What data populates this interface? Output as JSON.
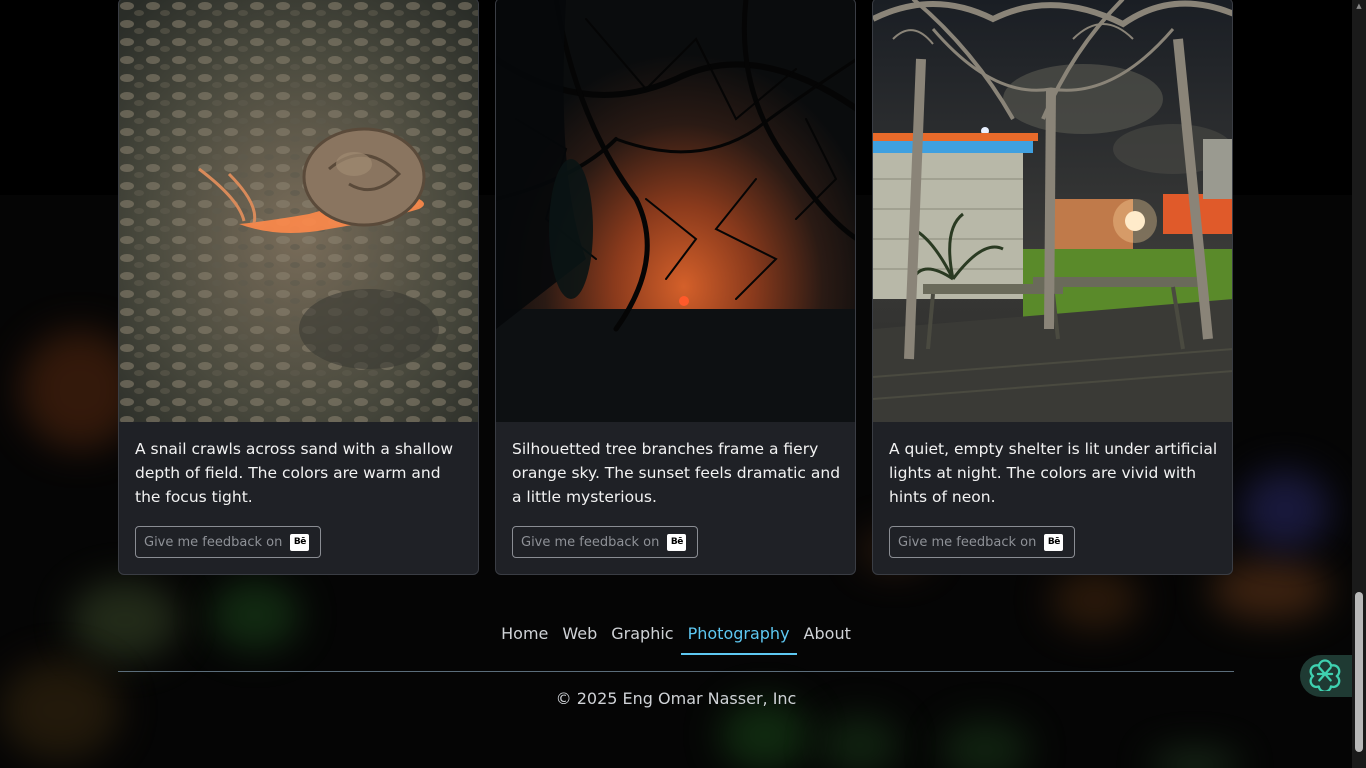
{
  "cards": [
    {
      "caption": "A snail crawls across sand with a shallow depth of field. The colors are warm and the focus tight.",
      "feedback_label": "Give me feedback on",
      "badge": "Bē"
    },
    {
      "caption": "Silhouetted tree branches frame a fiery orange sky. The sunset feels dramatic and a little mysterious.",
      "feedback_label": "Give me feedback on",
      "badge": "Bē"
    },
    {
      "caption": "A quiet, empty shelter is lit under artificial lights at night. The colors are vivid with hints of neon.",
      "feedback_label": "Give me feedback on",
      "badge": "Bē"
    }
  ],
  "footer": {
    "nav": [
      "Home",
      "Web",
      "Graphic",
      "Photography",
      "About"
    ],
    "active": "Photography",
    "copyright": "© 2025 Eng Omar Nasser, Inc"
  },
  "colors": {
    "accent": "#5ec8f2",
    "card_bg": "#1f2126",
    "assistant_icon": "#3fd1b0"
  },
  "icons": {
    "feedback_badge": "behance-icon",
    "assistant": "ai-assistant-icon"
  }
}
